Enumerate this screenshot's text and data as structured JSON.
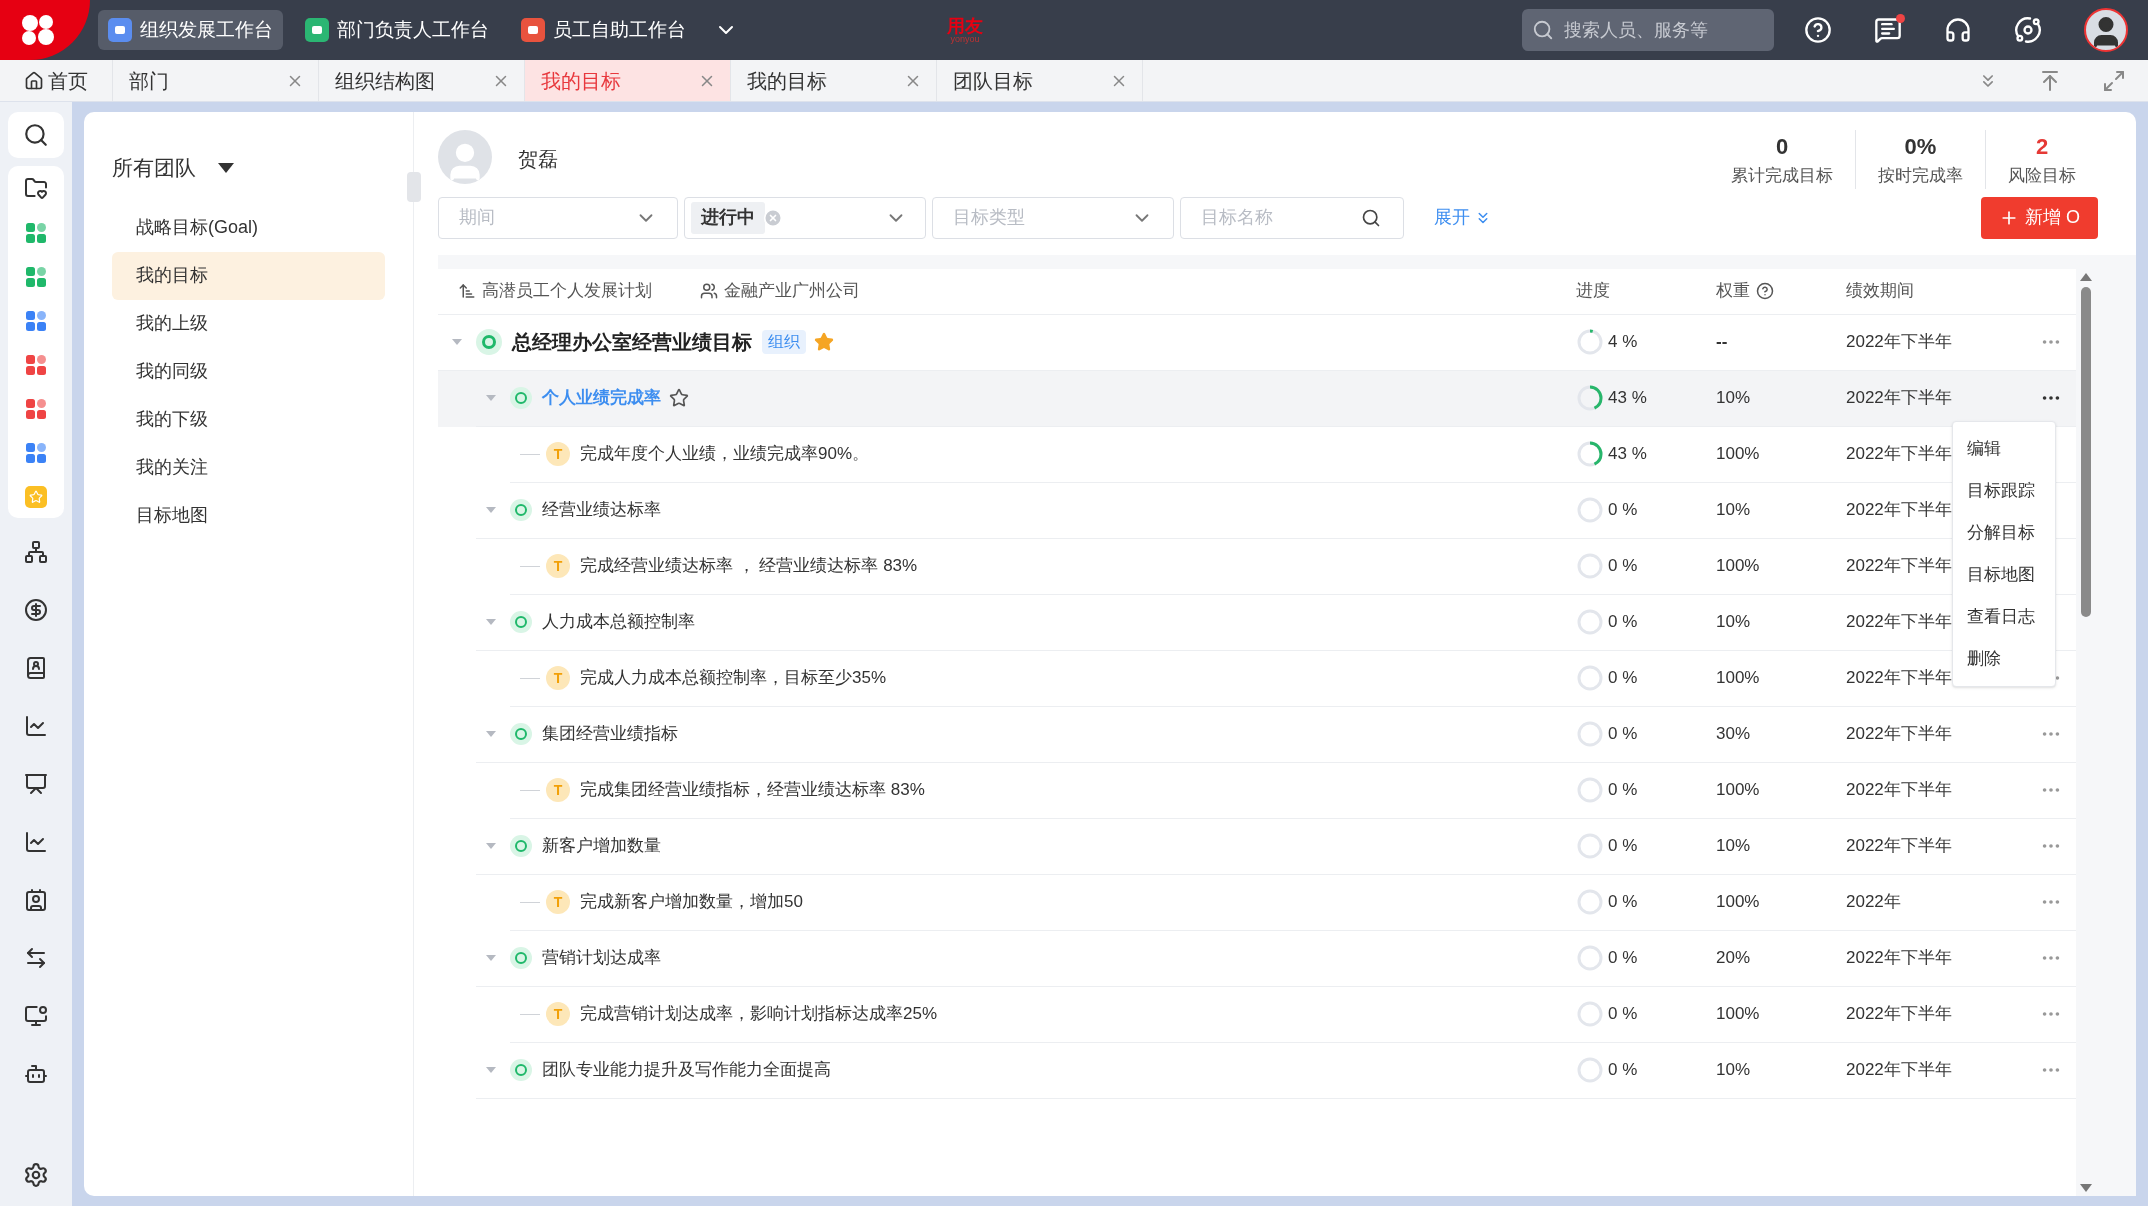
{
  "top_bar": {
    "brand": "用友",
    "brand_sub": "yonyou",
    "workspaces": [
      {
        "label": "组织发展工作台",
        "selected": true,
        "kind": "org"
      },
      {
        "label": "部门负责人工作台",
        "selected": false,
        "kind": "dept"
      },
      {
        "label": "员工自助工作台",
        "selected": false,
        "kind": "self"
      }
    ],
    "search": {
      "placeholder": "搜索人员、服务等"
    },
    "notification_dot": true
  },
  "tabs": [
    {
      "label": "首页",
      "selected": false,
      "closable": false
    },
    {
      "label": "部门",
      "selected": false,
      "closable": true
    },
    {
      "label": "组织结构图",
      "selected": false,
      "closable": true
    },
    {
      "label": "我的目标",
      "selected": true,
      "closable": true
    },
    {
      "label": "我的目标",
      "selected": false,
      "closable": true
    },
    {
      "label": "团队目标",
      "selected": false,
      "closable": true
    }
  ],
  "sidebar": {
    "title": "所有团队",
    "items": [
      {
        "label": "战略目标(Goal)",
        "selected": false
      },
      {
        "label": "我的目标",
        "selected": true
      },
      {
        "label": "我的上级",
        "selected": false
      },
      {
        "label": "我的同级",
        "selected": false
      },
      {
        "label": "我的下级",
        "selected": false
      },
      {
        "label": "我的关注",
        "selected": false
      },
      {
        "label": "目标地图",
        "selected": false
      }
    ]
  },
  "user": {
    "name": "贺磊"
  },
  "stats": [
    {
      "value": "0",
      "label": "累计完成目标",
      "alert": false
    },
    {
      "value": "0%",
      "label": "按时完成率",
      "alert": false
    },
    {
      "value": "2",
      "label": "风险目标",
      "alert": true
    }
  ],
  "filters": {
    "period": {
      "placeholder": "期间"
    },
    "status": {
      "value": "进行中"
    },
    "type": {
      "placeholder": "目标类型"
    },
    "name": {
      "placeholder": "目标名称"
    },
    "expand": "展开"
  },
  "add_button": "新增 O",
  "table": {
    "plan": "高潜员工个人发展计划",
    "company": "金融产业广州公司",
    "columns": [
      "进度",
      "权重",
      "绩效期间"
    ],
    "rows": [
      {
        "kind": "goal",
        "name": "总经理办公室经营业绩目标",
        "tag": "组织",
        "starred": true,
        "progress": "4 %",
        "level": 0.04,
        "weight": "--",
        "period": "2022年下半年",
        "expanded": true,
        "selected": false,
        "more": true,
        "children": [
          {
            "kind": "goal",
            "name": "个人业绩完成率",
            "starred": false,
            "progress": "43 %",
            "level": 0.43,
            "weight": "10%",
            "period": "2022年下半年",
            "expanded": true,
            "selected": true,
            "more": true,
            "menu_open": true,
            "children": [
              {
                "kind": "result",
                "icon": "T",
                "name": "完成年度个人业绩，业绩完成率90%。",
                "progress": "43 %",
                "level": 0.43,
                "weight": "100%",
                "period": "2022年下半年",
                "selected": false,
                "more": false
              }
            ]
          },
          {
            "kind": "goal",
            "name": "经营业绩达标率",
            "progress": "0 %",
            "level": 0,
            "weight": "10%",
            "period": "2022年下半年",
            "expanded": true,
            "selected": false,
            "more": false,
            "children": [
              {
                "kind": "result",
                "icon": "T",
                "name": "完成经营业绩达标率 ， 经营业绩达标率 83%",
                "progress": "0 %",
                "level": 0,
                "weight": "100%",
                "period": "2022年下半年",
                "selected": false,
                "more": false
              }
            ]
          },
          {
            "kind": "goal",
            "name": "人力成本总额控制率",
            "progress": "0 %",
            "level": 0,
            "weight": "10%",
            "period": "2022年下半年",
            "expanded": true,
            "selected": false,
            "more": false,
            "children": [
              {
                "kind": "result",
                "icon": "T",
                "name": "完成人力成本总额控制率，目标至少35%",
                "progress": "0 %",
                "level": 0,
                "weight": "100%",
                "period": "2022年下半年",
                "selected": false,
                "more": true
              }
            ]
          },
          {
            "kind": "goal",
            "name": "集团经营业绩指标",
            "progress": "0 %",
            "level": 0,
            "weight": "30%",
            "period": "2022年下半年",
            "expanded": true,
            "selected": false,
            "more": true,
            "children": [
              {
                "kind": "result",
                "icon": "T",
                "name": "完成集团经营业绩指标，经营业绩达标率 83%",
                "progress": "0 %",
                "level": 0,
                "weight": "100%",
                "period": "2022年下半年",
                "selected": false,
                "more": true
              }
            ]
          },
          {
            "kind": "goal",
            "name": "新客户增加数量",
            "progress": "0 %",
            "level": 0,
            "weight": "10%",
            "period": "2022年下半年",
            "expanded": true,
            "selected": false,
            "more": true,
            "children": [
              {
                "kind": "result",
                "icon": "T",
                "name": "完成新客户增加数量，增加50",
                "progress": "0 %",
                "level": 0,
                "weight": "100%",
                "period": "2022年",
                "selected": false,
                "more": true
              }
            ]
          },
          {
            "kind": "goal",
            "name": "营销计划达成率",
            "progress": "0 %",
            "level": 0,
            "weight": "20%",
            "period": "2022年下半年",
            "expanded": true,
            "selected": false,
            "more": true,
            "children": [
              {
                "kind": "result",
                "icon": "T",
                "name": "完成营销计划达成率，影响计划指标达成率25%",
                "progress": "0 %",
                "level": 0,
                "weight": "100%",
                "period": "2022年下半年",
                "selected": false,
                "more": true
              }
            ]
          },
          {
            "kind": "goal",
            "name": "团队专业能力提升及写作能力全面提高",
            "progress": "0 %",
            "level": 0,
            "weight": "10%",
            "period": "2022年下半年",
            "expanded": true,
            "selected": false,
            "more": true
          }
        ]
      }
    ]
  },
  "context_menu": [
    "编辑",
    "目标跟踪",
    "分解目标",
    "目标地图",
    "查看日志",
    "删除"
  ]
}
